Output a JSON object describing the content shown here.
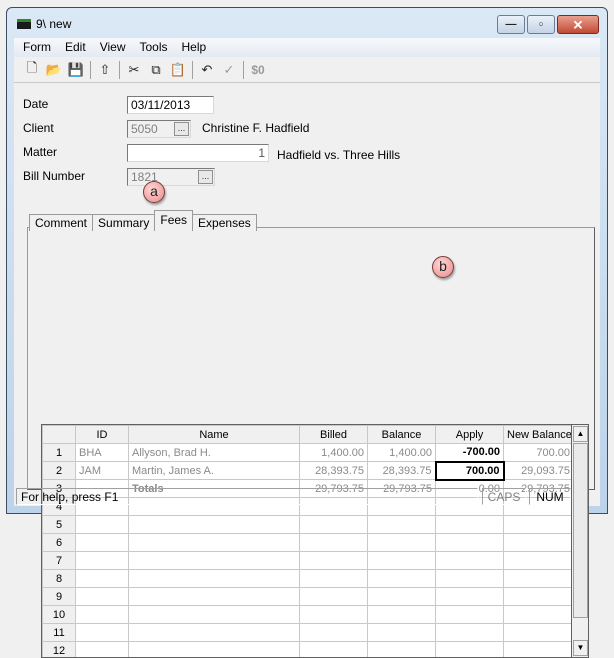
{
  "window": {
    "title": "9\\ new",
    "controls": {
      "minimize": "—",
      "maximize": "▫",
      "close": "✕"
    }
  },
  "menu": [
    "Form",
    "Edit",
    "View",
    "Tools",
    "Help"
  ],
  "toolbar": {
    "new": "🗋",
    "open": "📂",
    "save": "💾",
    "up": "⇧",
    "cut": "✂",
    "copy": "⧉",
    "paste": "📋",
    "undo": "↶",
    "spell": "✓",
    "dollar": "$0"
  },
  "form": {
    "date_label": "Date",
    "date_value": "03/11/2013",
    "client_label": "Client",
    "client_value": "5050",
    "client_name": "Christine F. Hadfield",
    "matter_label": "Matter",
    "matter_value": "1",
    "matter_name": "Hadfield vs. Three Hills",
    "bill_label": "Bill Number",
    "bill_value": "1821",
    "ellipsis": "..."
  },
  "callouts": {
    "a": "a",
    "b": "b"
  },
  "tabs": [
    "Comment",
    "Summary",
    "Fees",
    "Expenses"
  ],
  "active_tab": "Fees",
  "grid": {
    "columns": [
      "",
      "ID",
      "Name",
      "Billed",
      "Balance",
      "Apply",
      "New Balance"
    ],
    "rows": [
      {
        "n": "1",
        "id": "BHA",
        "name": "Allyson, Brad H.",
        "billed": "1,400.00",
        "balance": "1,400.00",
        "apply": "-700.00",
        "new_balance": "700.00"
      },
      {
        "n": "2",
        "id": "JAM",
        "name": "Martin, James A.",
        "billed": "28,393.75",
        "balance": "28,393.75",
        "apply": "700.00",
        "new_balance": "29,093.75"
      },
      {
        "n": "3",
        "id": "",
        "name": "Totals",
        "billed": "29,793.75",
        "balance": "29,793.75",
        "apply": "0.00",
        "new_balance": "29,793.75"
      },
      {
        "n": "4"
      },
      {
        "n": "5"
      },
      {
        "n": "6"
      },
      {
        "n": "7"
      },
      {
        "n": "8"
      },
      {
        "n": "9"
      },
      {
        "n": "10"
      },
      {
        "n": "11"
      },
      {
        "n": "12"
      }
    ],
    "scroll_up": "▲",
    "scroll_down": "▼"
  },
  "status": {
    "help": "For help, press F1",
    "caps": "CAPS",
    "num": "NUM"
  }
}
